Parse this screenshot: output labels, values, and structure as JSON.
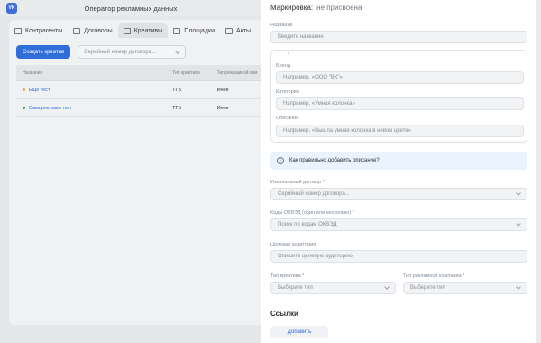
{
  "app": {
    "logo": "VK",
    "title": "Оператор рекламных данных",
    "tabs": [
      {
        "label": "Контрагенты",
        "icon": "people-icon"
      },
      {
        "label": "Договоры",
        "icon": "document-icon"
      },
      {
        "label": "Креативы",
        "icon": "image-icon",
        "active": true
      },
      {
        "label": "Площадки",
        "icon": "megaphone-icon"
      },
      {
        "label": "Акты",
        "icon": "act-icon"
      }
    ],
    "toolbar": {
      "create_button": "Создать креатив",
      "contract_select_placeholder": "Серийный номер договора..."
    },
    "table": {
      "headers": [
        "Название",
        "Тип креатива",
        "Тип рекламной кам"
      ],
      "rows": [
        {
          "name": "Ещё тест",
          "type": "ТГБ",
          "campaign": "Иное",
          "status_color": "#f5a623"
        },
        {
          "name": "Самореклама тест",
          "type": "ТГБ",
          "campaign": "Иное",
          "status_color": "#2fa84f"
        }
      ]
    }
  },
  "panel": {
    "marking_label": "Маркировка:",
    "marking_value": "не присвоена",
    "name_label": "Название",
    "name_placeholder": "Введите название",
    "required_star": "*",
    "brand_label": "Бренд",
    "brand_placeholder": "Например, «ООО \"ВК\"»",
    "category_label": "Категория",
    "category_placeholder": "Например, «Умная колонка»",
    "description_label": "Описание",
    "description_placeholder": "Например, «Вышла умная колонка в новом цвете»",
    "info_text": "Как правильно добавить описание?",
    "contract_label": "Изначальный договор *",
    "contract_placeholder": "Серийный номер договора...",
    "okved_label": "Коды ОКВЭД (один или несколько) *",
    "okved_placeholder": "Поиск по кодам ОКВЭД",
    "audience_label": "Целевая аудитория",
    "audience_placeholder": "Опишите целевую аудиторию",
    "creative_type_label": "Тип креатива *",
    "creative_type_placeholder": "Выберите тип",
    "campaign_type_label": "Тип рекламной компании *",
    "campaign_type_placeholder": "Выберите тип",
    "links_heading": "Ссылки",
    "add_button": "Добавить"
  }
}
